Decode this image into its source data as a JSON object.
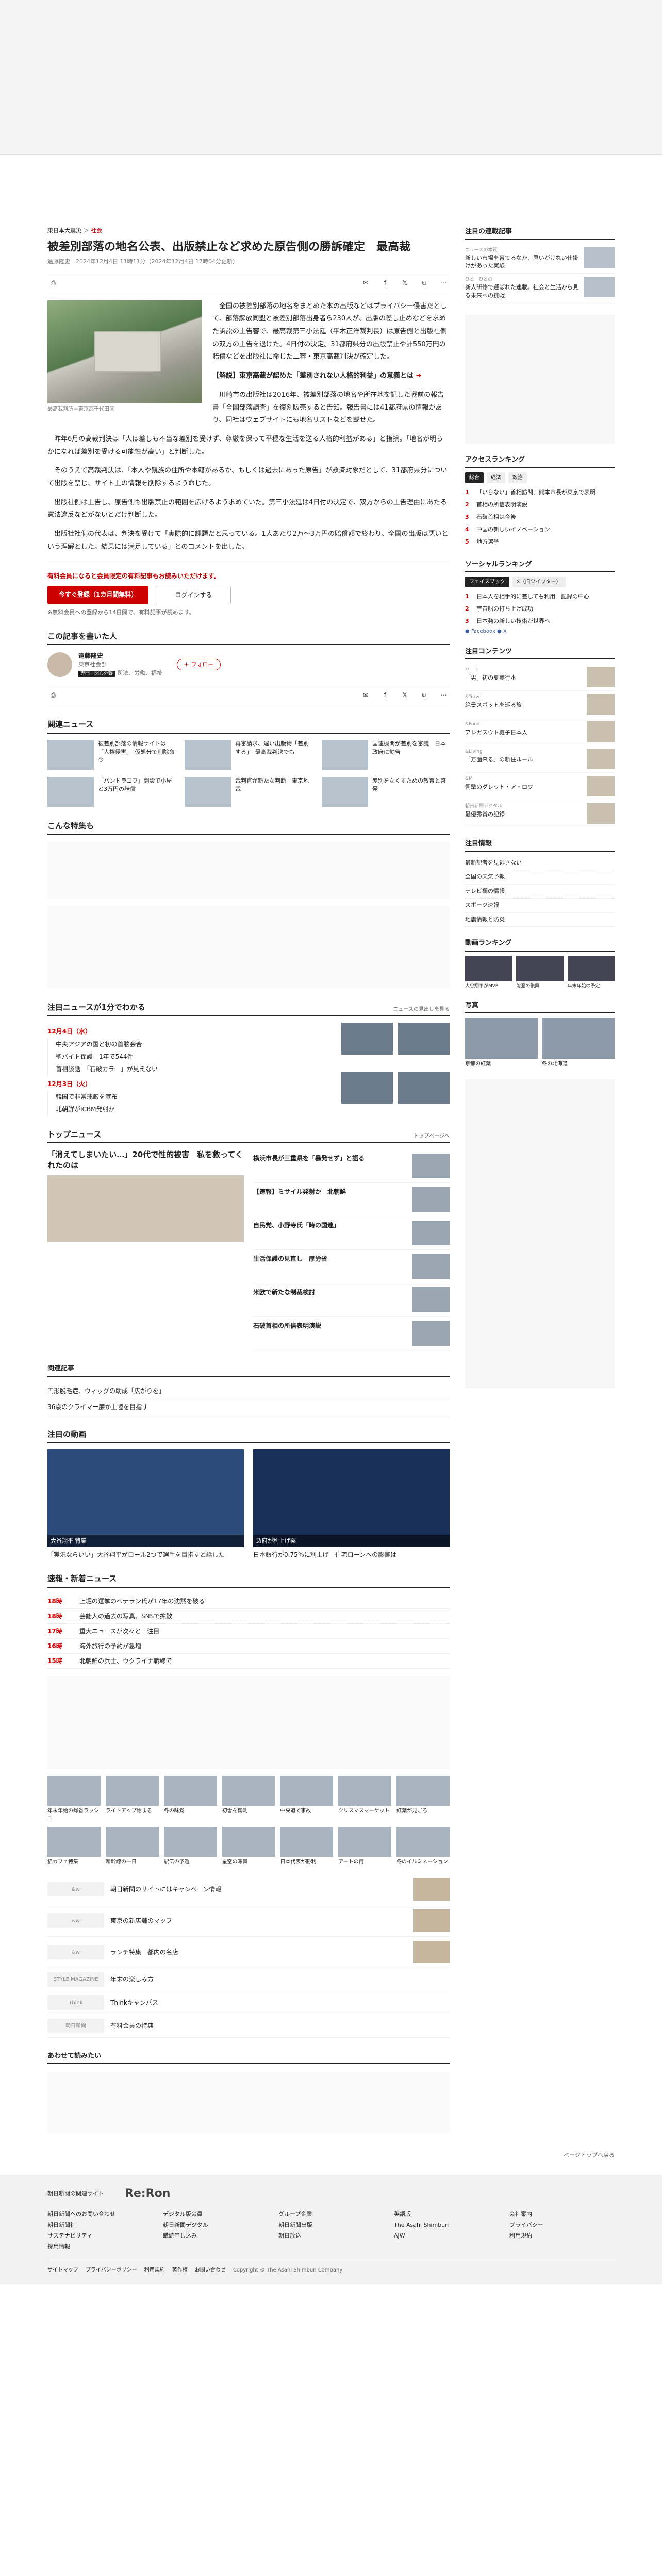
{
  "breadcrumb": {
    "section": "東日本大震災",
    "sub": "社会"
  },
  "article": {
    "title": "被差別部落の地名公表、出版禁止など求めた原告側の勝訴確定　最高裁",
    "meta": "遠藤隆史　2024年12月4日 11時11分（2024年12月4日 17時04分更新）",
    "photo_caption": "最高裁判所＝東京都千代田区",
    "paragraphs": [
      "全国の被差別部落の地名をまとめた本の出版などはプライバシー侵害だとして、部落解放同盟と被差別部落出身者ら230人が、出版の差し止めなどを求めた訴訟の上告審で、最高裁第三小法廷（平木正洋裁判長）は原告側と出版社側の双方の上告を退けた。4日付の決定。31都府県分の出版禁止や計550万円の賠償などを出版社に命じた二審・東京高裁判決が確定した。",
      "川崎市の出版社は2016年、被差別部落の地名や所在地を記した戦前の報告書「全国部落調査」を復刻販売すると告知。報告書には41都府県の情報があり、同社はウェブサイトにも地名リストなどを載せた。",
      "昨年6月の高裁判決は「人は差しも不当な差別を受けず、尊厳を保って平穏な生活を送る人格的利益がある」と指摘。「地名が明らかになれば差別を受ける可能性が高い」と判断した。",
      "そのうえで高裁判決は、「本人や親族の住所や本籍があるか、もしくは過去にあった原告」が救済対象だとして、31都府県分について出版を禁じ、サイト上の情報を削除するよう命じた。",
      "出版社側は上告し、原告側も出版禁止の範囲を広げるよう求めていた。第三小法廷は4日付の決定で、双方からの上告理由にあたる憲法違反などがないとだけ判断した。",
      "出版社社側の代表は、判決を受けて「実際的に課題だと思っている。1人あたり2万〜3万円の賠償額で終わり、全国の出版は悪いという理解とした。結果には満足している」とのコメントを出した。"
    ],
    "related_link": "【解説】東京高裁が認めた「差別されない人格的利益」の意義とは",
    "paywall_lead": "有料会員になると会員限定の有料記事もお読みいただけます。",
    "btn_register": "今すぐ登録（1カ月間無料）",
    "btn_login": "ログインする",
    "paywall_note": "※無料会員への登録から14日間で、有料記事が読めます。"
  },
  "author": {
    "heading": "この記事を書いた人",
    "name": "遠藤隆史",
    "desc": "東京社会部",
    "badge": "専門・関心分野",
    "fields": "司法、労働、福祉",
    "follow": "フォロー"
  },
  "related": {
    "heading": "関連ニュース",
    "items": [
      "被差別部落の情報サイトは「人権侵害」　仮処分で削除命令",
      "再審請求、遅い出版物「差別する」　最高裁判決でも",
      "国連機関が差別を審議　日本政府に勧告",
      "「パンドラコフ」開設で小屋と3万円の賠償",
      "裁判官が新たな判断　東京地裁",
      "差別をなくすための教育と啓発"
    ]
  },
  "special": {
    "heading": "こんな特集も"
  },
  "timeline": {
    "heading": "注目ニュースが1分でわかる",
    "more": "ニュースの見出しを見る",
    "days": [
      {
        "date": "12月4日（水）",
        "items": [
          "中央アジアの国と初の首脳会合",
          "聖バイト保護　1年で544件",
          "首相談話　「石破カラー」が見えない"
        ]
      },
      {
        "date": "12月3日（火）",
        "items": [
          "韓国で非常戒厳を宣布",
          "北朝鮮がICBM発射か"
        ]
      }
    ]
  },
  "top_news": {
    "heading": "トップニュース",
    "more": "トップページへ",
    "big_title": "「消えてしまいたい…」20代で性的被害　私を救ってくれたのは",
    "items": [
      "横浜市長が三重県を「暴発せず」と語る",
      "【速報】ミサイル発射か　北朝鮮",
      "自民党、小野寺氏「時の国連」",
      "生活保護の見直し　厚労省",
      "米欧で新たな制裁検討",
      "石破首相の所信表明演説"
    ]
  },
  "feature": {
    "heading": "関連記事",
    "items": [
      "円形脱毛症、ウィッグの助成「広がりを」",
      "36歳のクライマー廉か上陸を目指す"
    ]
  },
  "videos": {
    "heading": "注目の動画",
    "items": [
      {
        "label": "大谷翔平 特集",
        "title": "「実況ならいい」大谷翔平がロール2つで選手を目指すと話した"
      },
      {
        "label": "政府が利上げ案",
        "title": "日本銀行が0.75％に利上げ　住宅ローンへの影響は"
      }
    ]
  },
  "flash": {
    "heading": "速報・新着ニュース",
    "rows": [
      {
        "time": "18時",
        "text": "上堀の選挙のベテラン氏が17年の沈黙を破る"
      },
      {
        "time": "18時",
        "text": "芸能人の過去の写真、SNSで拡散"
      },
      {
        "time": "17時",
        "text": "重大ニュースが次々と　注目"
      },
      {
        "time": "16時",
        "text": "海外旅行の予約が急増"
      },
      {
        "time": "15時",
        "text": "北朝鮮の兵士、ウクライナ戦線で"
      }
    ]
  },
  "photos": {
    "items": [
      "年末年始の帰省ラッシュ",
      "ライトアップ始まる",
      "冬の味覚",
      "初雪を観測",
      "中央道で事故",
      "クリスマスマーケット",
      "紅葉が見ごろ",
      "猫カフェ特集",
      "新幹線の一日",
      "駅伝の予選",
      "星空の写真",
      "日本代表が勝利",
      "アートの街",
      "冬のイルミネーション"
    ]
  },
  "brands": {
    "items": [
      {
        "logo": "&w",
        "text": "朝日新聞のサイトにはキャンペーン情報"
      },
      {
        "logo": "&w",
        "text": "東京の新店舗のマップ"
      },
      {
        "logo": "&w",
        "text": "ランチ特集　都内の名店"
      },
      {
        "logo": "STYLE MAGAZINE",
        "text": "年末の楽しみ方"
      },
      {
        "logo": "Think",
        "text": "Thinkキャンパス"
      },
      {
        "logo": "朝日新聞",
        "text": "有料会員の特典"
      }
    ],
    "more_heading": "あわせて読みたい"
  },
  "side": {
    "featured_heading": "注目の連載記事",
    "featured": [
      {
        "label": "ニュースの本質",
        "title": "新しい市場を育てるなか、思いがけない仕掛けがあった実験"
      },
      {
        "label": "ひと　ひとの",
        "title": "新人研修で選ばれた連載。社会と生活から見る未来への挑戦"
      }
    ],
    "ranking_heading": "アクセスランキング",
    "ranking_tabs": [
      "総合",
      "経済",
      "政治"
    ],
    "ranking": [
      "「いらない」首相訪問、熊本市長が東京で表明",
      "首相の所信表明演説",
      "石破首相は今後",
      "中国の新しいイノベーション",
      "地方選挙"
    ],
    "social_heading": "ソーシャルランキング",
    "social_tabs": [
      "フェイスブック",
      "X（旧ツイッター）"
    ],
    "social": [
      "日本人を相手的に差しても利用　記録の中心",
      "宇宙船の打ち上げ成功",
      "日本発の新しい技術が世界へ"
    ],
    "contents_heading": "注目コンテンツ",
    "contents": [
      {
        "k": "ハート",
        "t": "「男」初の夏実行本"
      },
      {
        "k": "&Travel",
        "t": "絶景スポットを巡る旅"
      },
      {
        "k": "&Food",
        "t": "アレガスウト機子日本人"
      },
      {
        "k": "&Living",
        "t": "「万面来る」の新住ルール"
      },
      {
        "k": "&M",
        "t": "衝撃のダレット・ア・ロワ"
      },
      {
        "k": "朝日新聞デジタル",
        "t": "最優秀賞の記録"
      }
    ],
    "sp_heading": "注目情報",
    "sp_list": [
      "最新記者を見逃さない",
      "全国の天気予報",
      "テレビ欄の情報",
      "スポーツ速報",
      "地震情報と防災"
    ],
    "video_rank_heading": "動画ランキング",
    "video_rank": [
      "大谷翔平がMVP",
      "能登の復興",
      "年末年始の予定"
    ],
    "photo_heading": "写真",
    "photo_items": [
      "京都の紅葉",
      "冬の北海道"
    ]
  },
  "footer": {
    "left": "朝日新聞の関連サイト",
    "logo": "Re:Ron",
    "cols": [
      [
        "朝日新聞へのお問い合わせ",
        "朝日新聞社",
        "サステナビリティ",
        "採用情報"
      ],
      [
        "デジタル版会員",
        "朝日新聞デジタル",
        "購読申し込み"
      ],
      [
        "グループ企業",
        "朝日新聞出版",
        "朝日放送"
      ],
      [
        "英語版",
        "The Asahi Shimbun",
        "AJW"
      ],
      [
        "会社案内",
        "プライバシー",
        "利用規約"
      ]
    ],
    "bottom": [
      "サイトマップ",
      "プライバシーポリシー",
      "利用規約",
      "著作権",
      "お問い合わせ",
      "Copyright © The Asahi Shimbun Company"
    ],
    "page_top": "ページトップへ戻る"
  }
}
